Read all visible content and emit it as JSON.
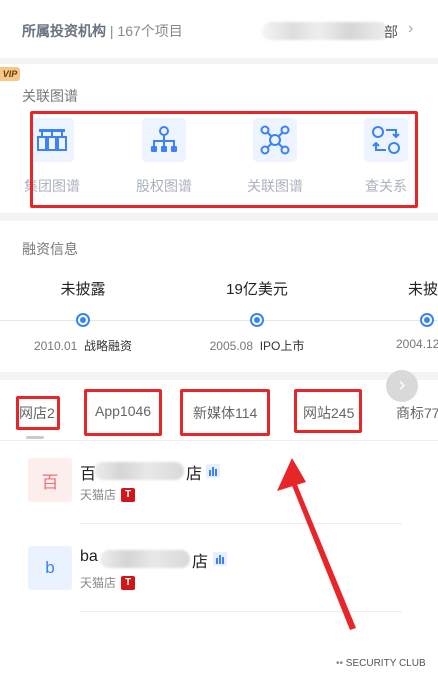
{
  "header": {
    "investor_label": "所属投资机构",
    "project_count": "| 167个项目",
    "dept_suffix": "部",
    "chevron": "chevron-right-icon"
  },
  "vip_badge": "VIP",
  "relation_graph": {
    "title": "关联图谱",
    "items": [
      {
        "label": "集团图谱",
        "icon": "group-graph-icon"
      },
      {
        "label": "股权图谱",
        "icon": "equity-graph-icon"
      },
      {
        "label": "关联图谱",
        "icon": "relation-graph-icon"
      },
      {
        "label": "查关系",
        "icon": "find-relation-icon"
      }
    ]
  },
  "financing": {
    "title": "融资信息",
    "events": [
      {
        "amount": "未披露",
        "date": "2010.01",
        "round": "战略融资"
      },
      {
        "amount": "19亿美元",
        "date": "2005.08",
        "round": "IPO上市"
      },
      {
        "amount": "未披",
        "date": "2004.12",
        "round": ""
      }
    ]
  },
  "tabs": [
    {
      "label": "网店2"
    },
    {
      "label": "App1046"
    },
    {
      "label": "新媒体114"
    },
    {
      "label": "网站245"
    },
    {
      "label": "商标77"
    }
  ],
  "shops": [
    {
      "logo_text": "百",
      "name_start": "百",
      "name_end": "店",
      "platform": "天猫店",
      "tag": "T"
    },
    {
      "logo_text": "b",
      "name_start": "ba",
      "name_end": "店",
      "platform": "天猫店",
      "tag": "T"
    }
  ],
  "watermark": "SECURITY CLUB",
  "colors": {
    "accent": "#3b82f6",
    "highlight_red": "#e8262a",
    "tmall_red": "#d0161b"
  }
}
